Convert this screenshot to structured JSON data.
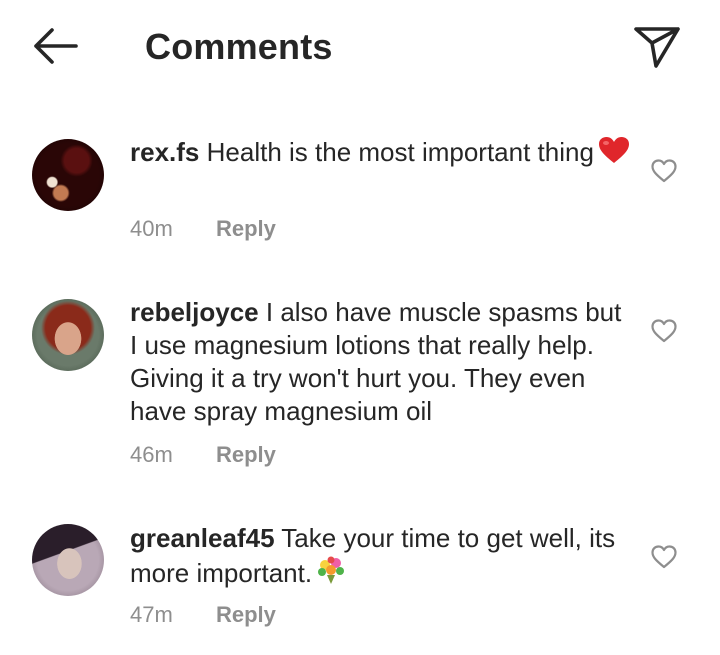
{
  "header": {
    "title": "Comments",
    "back_icon": "arrow-left-icon",
    "send_icon": "paper-plane-icon"
  },
  "comments": [
    {
      "username": "rex.fs",
      "text": "Health is the most important thing",
      "emoji": "heart-emoji",
      "time": "40m",
      "reply_label": "Reply"
    },
    {
      "username": "rebeljoyce",
      "text": "I also have muscle spasms but I use magnesium lotions that really help. Giving it a try won't hurt you. They even have spray magnesium oil",
      "time": "46m",
      "reply_label": "Reply"
    },
    {
      "username": "greanleaf45",
      "text": "Take your time to get well, its more important.",
      "emoji": "bouquet-emoji",
      "time": "47m",
      "reply_label": "Reply"
    }
  ],
  "colors": {
    "text": "#262626",
    "secondary": "#8e8e8e",
    "heart": "#e0262b"
  }
}
